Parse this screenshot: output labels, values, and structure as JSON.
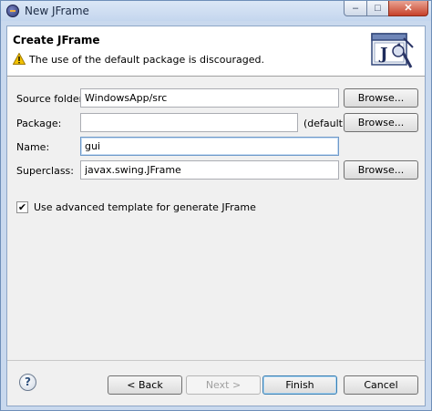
{
  "window": {
    "title": "New JFrame",
    "controls": {
      "minimize": "–",
      "maximize": "□",
      "close": "✕"
    }
  },
  "header": {
    "title": "Create JFrame",
    "warning": "The use of the default package is discouraged."
  },
  "form": {
    "source_folder": {
      "label": "Source folder:",
      "value": "WindowsApp/src",
      "browse": "Browse..."
    },
    "package": {
      "label": "Package:",
      "value": "",
      "default_text": "(default)",
      "browse": "Browse..."
    },
    "name": {
      "label": "Name:",
      "value": "gui"
    },
    "superclass": {
      "label": "Superclass:",
      "value": "javax.swing.JFrame",
      "browse": "Browse..."
    }
  },
  "options": {
    "advanced_template": {
      "label": "Use advanced template for generate JFrame",
      "checked": true,
      "mark": "✔"
    }
  },
  "footer": {
    "help": "?",
    "back": "< Back",
    "next": "Next >",
    "finish": "Finish",
    "cancel": "Cancel"
  },
  "colors": {
    "accent": "#3c7fb1",
    "warning": "#f2c200"
  },
  "icons": {
    "warning": "warning-icon",
    "help": "help-icon",
    "banner": "java-jframe-banner-icon"
  }
}
